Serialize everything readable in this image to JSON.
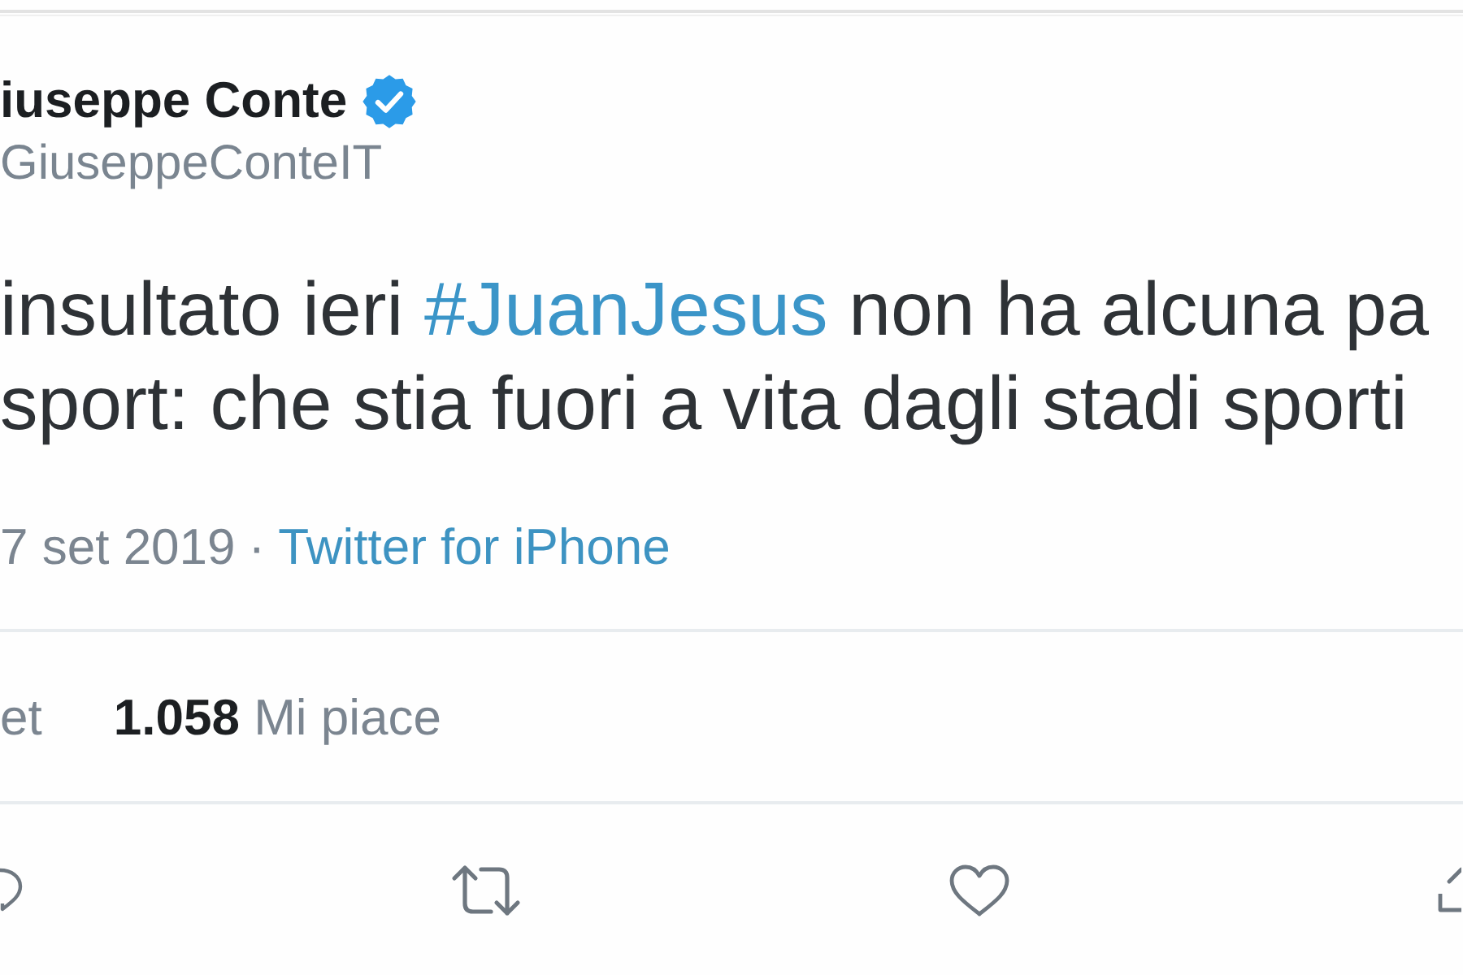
{
  "tweet": {
    "author": {
      "name": "iuseppe Conte",
      "verified": true,
      "handle": "GiuseppeConteIT"
    },
    "text_lines": [
      {
        "segments": [
          {
            "kind": "text",
            "text": "insultato ieri "
          },
          {
            "kind": "hashtag",
            "text": "#JuanJesus"
          },
          {
            "kind": "text",
            "text": " non ha alcuna pa"
          }
        ]
      },
      {
        "segments": [
          {
            "kind": "text",
            "text": "sport: che stia fuori a vita dagli stadi sporti"
          }
        ]
      }
    ],
    "date": "7 set 2019",
    "separator": "·",
    "source": "Twitter for iPhone",
    "stats": [
      {
        "label": "et"
      },
      {
        "count": "1.058",
        "label": "Mi piace"
      }
    ]
  }
}
